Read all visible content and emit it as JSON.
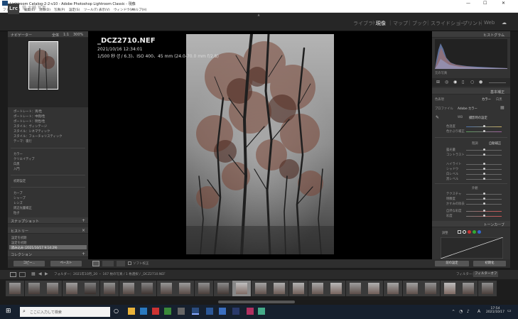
{
  "window": {
    "title": "Lightroom Catalog-2-2-v10 - Adobe Photoshop Lightroom Classic - 現像",
    "minimize": "—",
    "maximize": "☐",
    "close": "✕"
  },
  "menu": [
    "ファイル(F)",
    "編集(E)",
    "現像(D)",
    "写真(P)",
    "設定(S)",
    "ツール(T)",
    "表示(V)",
    "ウィンドウ(W)",
    "ヘルプ(H)"
  ],
  "header": {
    "badge": "Lrc",
    "identity": "菅 大輔 写真",
    "modules": [
      "ライブラリ",
      "現像",
      "マップ",
      "ブック",
      "スライドショー",
      "プリント",
      "Web"
    ],
    "active_module": "現像"
  },
  "left_panel": {
    "navigator_title": "ナビゲーター",
    "navigator_zoom": [
      "全体",
      "1:1",
      "300%"
    ],
    "presets": [
      "ポートレート：男/性",
      "ポートレート：中間/性",
      "ポートレート：明性/性",
      "スタイル：ヴィンテージ",
      "スタイル：シネマティック",
      "スタイル：フューチャリスティック",
      "テーマ：夜行"
    ],
    "groups": [
      "カラー",
      "クリエイティブ",
      "白黒",
      "入門"
    ],
    "user_group": "初期設定",
    "sections": [
      "カーブ",
      "シャープ",
      "レンズ",
      "周辺光量補正",
      "粒子"
    ],
    "snapshots_title": "スナップショット",
    "history_title": "ヒストリー",
    "history": [
      "設定を初期",
      "設定を初期",
      "読み込み (2021/10/17 9:14:29)"
    ],
    "collections_title": "コレクション",
    "copy_button": "コピー...",
    "paste_button": "ペースト"
  },
  "photo": {
    "filename": "_DCZ2710.NEF",
    "datetime": "2021/10/16 12:34:01",
    "exif": "1/500 秒 (ƒ / 6.3)、ISO 400、45 mm (24.0-70.0 mm f/2.8)"
  },
  "toolbar": {
    "softproof": "ソフト校正"
  },
  "right_panel": {
    "histogram_title": "ヒストグラム",
    "original_label": "元の写真",
    "basic_title": "基本補正",
    "treatment_label": "色表現",
    "treatment_color": "カラー",
    "treatment_bw": "白黒",
    "profile_label": "プロファイル",
    "profile_value": "Adobe カラー",
    "wb_label": "WB",
    "wb_value": "撮影時の設定",
    "sliders_wb": [
      "色温度",
      "色かぶり補正"
    ],
    "tone_label": "階調",
    "auto_label": "自動補正",
    "sliders_tone": [
      "露光量",
      "コントラスト",
      "ハイライト",
      "シャドウ",
      "白レベル",
      "黒レベル"
    ],
    "presence_label": "外観",
    "sliders_presence": [
      "テクスチャ",
      "明瞭度",
      "かすみの除去",
      "自然な彩度",
      "彩度"
    ],
    "tonecurve_title": "トーンカーブ",
    "tonecurve_channel": "調整",
    "prev_button": "前の設定",
    "reset_button": "初期化"
  },
  "filmstrip": {
    "breadcrumb": "フォルダー：2021年10月_20 ・ 167 枚の写真 / 1 枚選択 / _DCZ2710.NEF",
    "filter_label": "フィルター：",
    "filter_value": "フィルターオフ",
    "thumb_count": 26,
    "selected_index": 12
  },
  "taskbar": {
    "search_placeholder": "ここに入力して検索",
    "time": "17:54",
    "date": "2021/10/17",
    "ime": "A"
  }
}
